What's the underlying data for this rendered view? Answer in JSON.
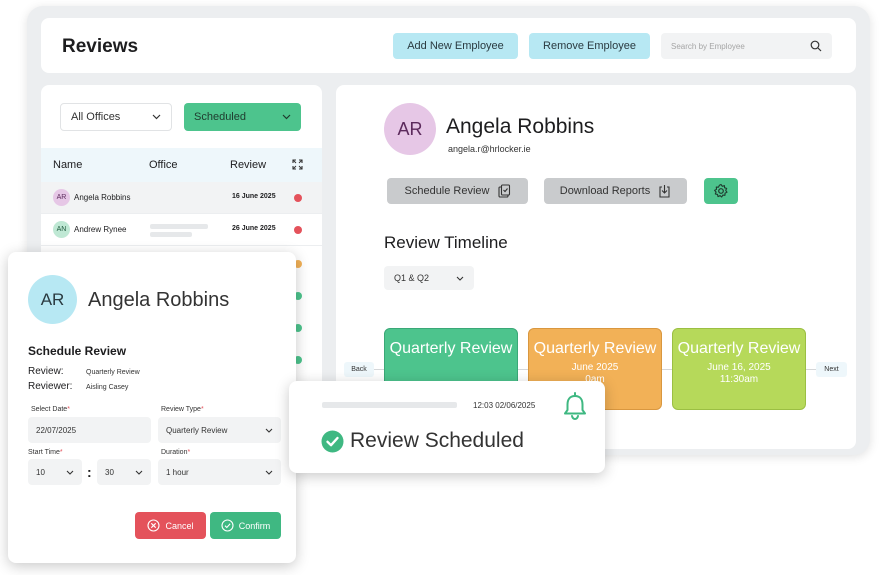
{
  "header": {
    "title": "Reviews",
    "add_employee_label": "Add New Employee",
    "remove_employee_label": "Remove Employee",
    "search_placeholder": "Search by Employee"
  },
  "filters": {
    "offices_selected": "All Offices",
    "status_selected": "Scheduled"
  },
  "table": {
    "columns": [
      "Name",
      "Office",
      "Review"
    ],
    "rows": [
      {
        "initials": "AR",
        "name": "Angela Robbins",
        "date": "16 June 2025",
        "status_color": "#e4525b"
      },
      {
        "initials": "AN",
        "name": "Andrew Rynee",
        "date": "26 June 2025",
        "status_color": "#e4525b"
      }
    ]
  },
  "profile": {
    "initials": "AR",
    "name": "Angela Robbins",
    "email": "angela.r@hrlocker.ie",
    "schedule_label": "Schedule Review",
    "download_label": "Download Reports"
  },
  "timeline": {
    "title": "Review Timeline",
    "period_selected": "Q1 & Q2",
    "back_label": "Back",
    "next_label": "Next",
    "cards": [
      {
        "title": "Quarterly Review",
        "date": "",
        "time": "",
        "color": "#4dc48d"
      },
      {
        "title": "Quarterly Review",
        "date": "June 2025",
        "time": "0am",
        "color": "#f2b157"
      },
      {
        "title": "Quarterly Review",
        "date": "June 16, 2025",
        "time": "11:30am",
        "color": "#b6d95a"
      }
    ]
  },
  "modal": {
    "initials": "AR",
    "name": "Angela Robbins",
    "title": "Schedule Review",
    "review_label": "Review:",
    "review_value": "Quarterly Review",
    "reviewer_label": "Reviewer:",
    "reviewer_value": "Aisling Casey",
    "select_date_label": "Select Date",
    "select_date_value": "22/07/2025",
    "review_type_label": "Review Type",
    "review_type_value": "Quarterly Review",
    "start_time_label": "Start Time",
    "start_hour": "10",
    "start_minute": "30",
    "duration_label": "Duration",
    "duration_value": "1 hour",
    "required_mark": "*",
    "time_separator": ":",
    "cancel_label": "Cancel",
    "confirm_label": "Confirm"
  },
  "toast": {
    "timestamp": "12:03 02/06/2025",
    "message": "Review Scheduled"
  },
  "colors": {
    "accent_green": "#4dc48d",
    "accent_blue": "#b7e8f3",
    "danger": "#e4525b"
  }
}
